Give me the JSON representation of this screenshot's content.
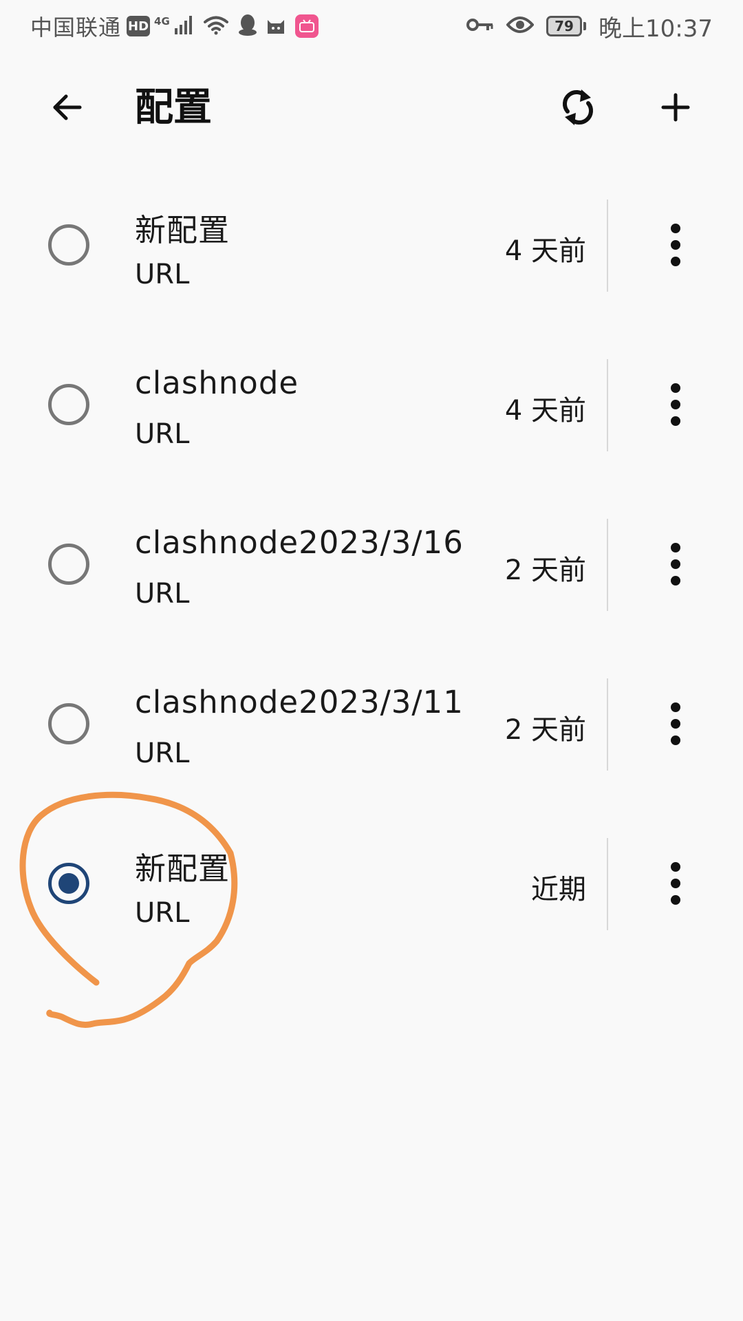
{
  "status_bar": {
    "carrier": "中国联通",
    "hd_badge": "HD",
    "network_type": "4G",
    "battery_level": "79",
    "time": "晚上10:37",
    "icons": [
      "signal-icon",
      "wifi-icon",
      "qq-icon",
      "cat-app-icon",
      "bilibili-icon",
      "key-icon",
      "eye-icon",
      "battery-icon"
    ],
    "app_badge_color": "#f0568f"
  },
  "app_bar": {
    "title": "配置",
    "back_icon": "arrow-left-icon",
    "refresh_icon": "refresh-icon",
    "add_icon": "plus-icon"
  },
  "profiles": [
    {
      "name": "新配置",
      "type": "URL",
      "updated": "4 天前",
      "selected": false
    },
    {
      "name": "clashnode",
      "type": "URL",
      "updated": "4 天前",
      "selected": false
    },
    {
      "name": "clashnode2023/3/16",
      "type": "URL",
      "updated": "2 天前",
      "selected": false
    },
    {
      "name": "clashnode2023/3/11",
      "type": "URL",
      "updated": "2 天前",
      "selected": false
    },
    {
      "name": "新配置",
      "type": "URL",
      "updated": "近期",
      "selected": true
    }
  ],
  "colors": {
    "background": "#f9f9f9",
    "radio_selected": "#1f4577",
    "radio_unselected": "#777777",
    "annotation_stroke": "#f0954a"
  }
}
